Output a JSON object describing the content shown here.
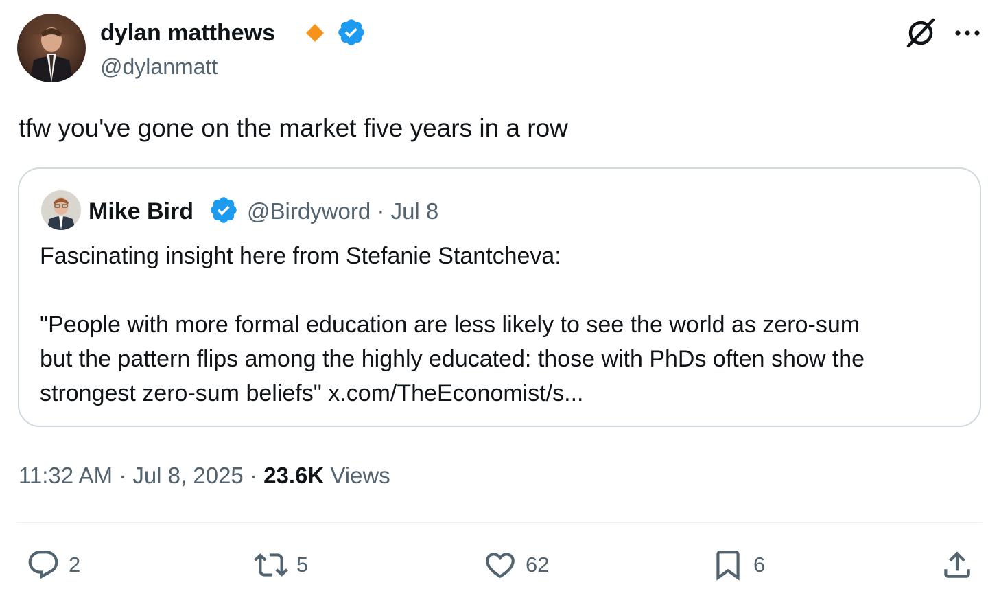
{
  "author": {
    "name": "dylan matthews",
    "handle": "@dylanmatt"
  },
  "tweet": {
    "text": "tfw you've gone on the market five years in a row"
  },
  "quoted_tweet": {
    "name": "Mike Bird",
    "handle": "@Birdyword",
    "date": "Jul 8",
    "separator": "·",
    "line1": "Fascinating insight here from Stefanie Stantcheva:",
    "line2": "\"People with more formal education are less likely to see the world as zero-sum",
    "line3": "but the pattern flips among the highly educated: those with PhDs often show the",
    "line4_text": "strongest zero-sum beliefs\"",
    "link": "x.com/TheEconomist/s..."
  },
  "meta": {
    "time": "11:32 AM",
    "separator": "·",
    "date": "Jul 8, 2025",
    "views_count": "23.6K",
    "views_label": "Views"
  },
  "actions": {
    "replies": "2",
    "reposts": "5",
    "likes": "62",
    "bookmarks": "6"
  },
  "colors": {
    "text_primary": "#0f1419",
    "text_secondary": "#536471",
    "verified_blue": "#1d9bf0",
    "diamond_orange": "#f7931a",
    "border": "#cfd9de"
  },
  "icons": {
    "main_avatar": "avatar-photo",
    "diamond": "diamond-badge-icon",
    "verified": "verified-badge-icon",
    "grok": "grok-icon",
    "more": "more-options-icon",
    "reply": "reply-icon",
    "repost": "repost-icon",
    "like": "heart-icon",
    "bookmark": "bookmark-icon",
    "share": "share-icon"
  }
}
